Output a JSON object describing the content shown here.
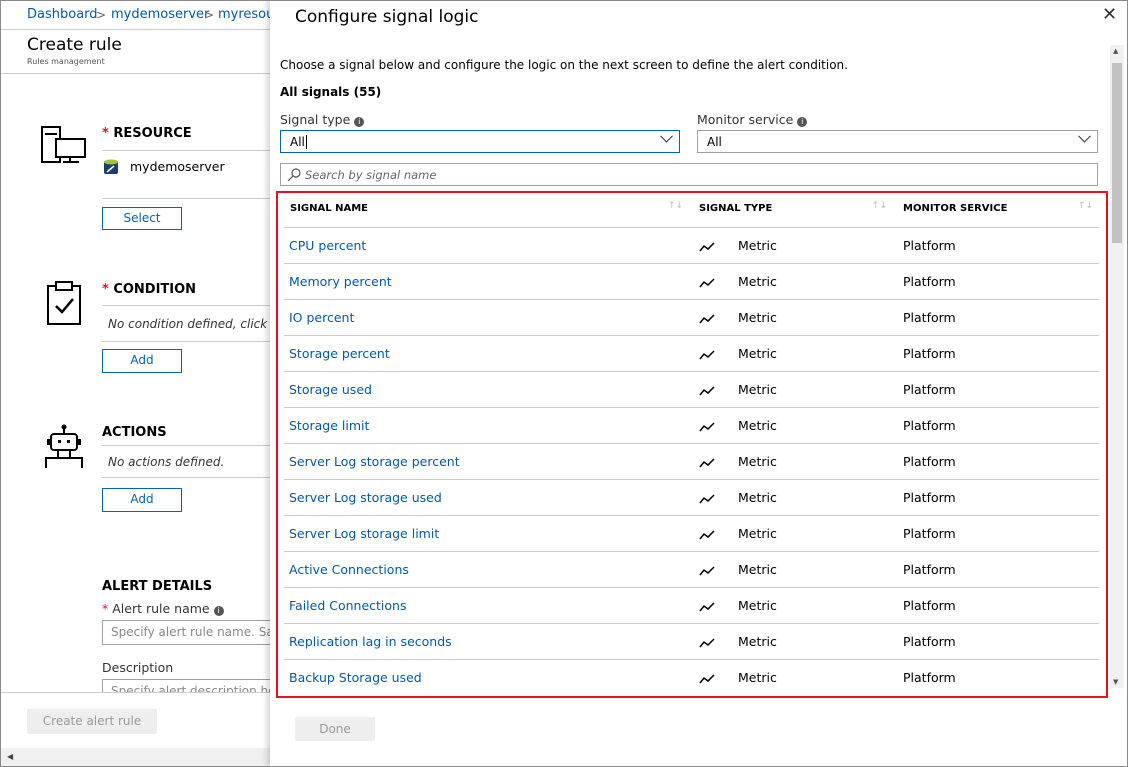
{
  "breadcrumb": [
    "Dashboard",
    "mydemoserver",
    "myresour"
  ],
  "page": {
    "title": "Create rule",
    "subtitle": "Rules management"
  },
  "resource": {
    "label": "RESOURCE",
    "name": "mydemoserver",
    "button": "Select"
  },
  "condition": {
    "label": "CONDITION",
    "text": "No condition defined, click on",
    "button": "Add"
  },
  "actions": {
    "label": "ACTIONS",
    "text": "No actions defined.",
    "button": "Add"
  },
  "alert_details": {
    "label": "ALERT DETAILS",
    "name_label": "Alert rule name",
    "name_placeholder": "Specify alert rule name. Sampl",
    "desc_label": "Description",
    "desc_placeholder": "Specify alert description here"
  },
  "footer": {
    "create_button": "Create alert rule"
  },
  "blade": {
    "title": "Configure signal logic",
    "intro": "Choose a signal below and configure the logic on the next screen to define the alert condition.",
    "count_label": "All signals (55)",
    "signal_type": {
      "label": "Signal type",
      "value": "All"
    },
    "monitor_service": {
      "label": "Monitor service",
      "value": "All"
    },
    "search_placeholder": "Search by signal name",
    "columns": [
      "SIGNAL NAME",
      "SIGNAL TYPE",
      "MONITOR SERVICE"
    ],
    "rows": [
      {
        "name": "CPU percent",
        "type": "Metric",
        "service": "Platform"
      },
      {
        "name": "Memory percent",
        "type": "Metric",
        "service": "Platform"
      },
      {
        "name": "IO percent",
        "type": "Metric",
        "service": "Platform"
      },
      {
        "name": "Storage percent",
        "type": "Metric",
        "service": "Platform"
      },
      {
        "name": "Storage used",
        "type": "Metric",
        "service": "Platform"
      },
      {
        "name": "Storage limit",
        "type": "Metric",
        "service": "Platform"
      },
      {
        "name": "Server Log storage percent",
        "type": "Metric",
        "service": "Platform"
      },
      {
        "name": "Server Log storage used",
        "type": "Metric",
        "service": "Platform"
      },
      {
        "name": "Server Log storage limit",
        "type": "Metric",
        "service": "Platform"
      },
      {
        "name": "Active Connections",
        "type": "Metric",
        "service": "Platform"
      },
      {
        "name": "Failed Connections",
        "type": "Metric",
        "service": "Platform"
      },
      {
        "name": "Replication lag in seconds",
        "type": "Metric",
        "service": "Platform"
      },
      {
        "name": "Backup Storage used",
        "type": "Metric",
        "service": "Platform"
      }
    ],
    "done_button": "Done"
  },
  "colors": {
    "link": "#0058ad",
    "accent": "#0063b1",
    "highlight": "#e81123"
  }
}
